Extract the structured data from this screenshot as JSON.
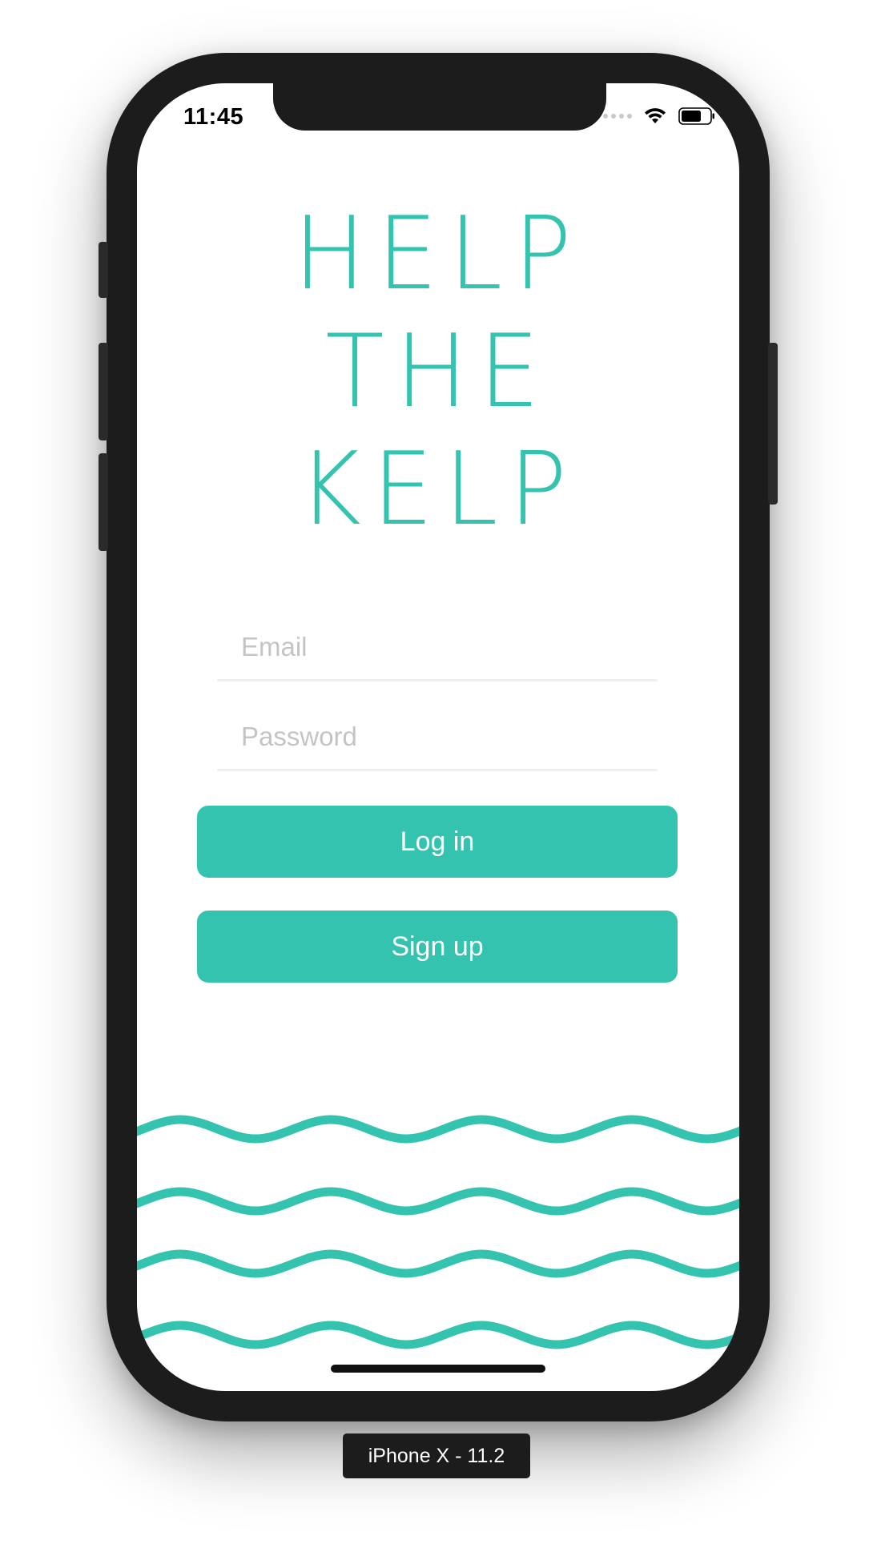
{
  "status_bar": {
    "time": "11:45"
  },
  "app": {
    "title_lines": [
      "HELP",
      "THE",
      "KELP"
    ],
    "accent_color": "#33c3ae"
  },
  "form": {
    "email_placeholder": "Email",
    "email_value": "",
    "password_placeholder": "Password",
    "password_value": ""
  },
  "buttons": {
    "login_label": "Log in",
    "signup_label": "Sign up"
  },
  "device_caption": "iPhone X - 11.2",
  "icons": [
    "signal-dots-icon",
    "wifi-icon",
    "battery-icon",
    "wave-decoration"
  ]
}
